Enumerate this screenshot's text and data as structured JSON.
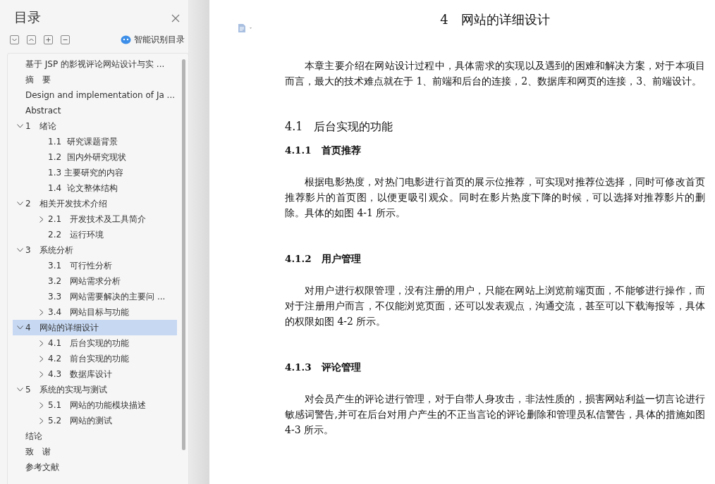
{
  "sidebar": {
    "title": "目录",
    "smart_toc_label": "智能识别目录",
    "items": [
      {
        "label": "基于 JSP 的影视评论网站设计与实 ...",
        "selected": false
      },
      {
        "label": "摘　要",
        "selected": false
      },
      {
        "label": "Design and implementation of Ja ...",
        "selected": false
      },
      {
        "label": "Abstract",
        "selected": false
      },
      {
        "label": "1　绪论",
        "selected": false,
        "expanded": true,
        "children": [
          {
            "label": "1.1  研究课题背景",
            "selected": false
          },
          {
            "label": "1.2  国内外研究现状",
            "selected": false
          },
          {
            "label": "1.3 主要研究的内容",
            "selected": false
          },
          {
            "label": "1.4  论文整体结构",
            "selected": false
          }
        ]
      },
      {
        "label": "2　相关开发技术介绍",
        "selected": false,
        "expanded": true,
        "children": [
          {
            "label": "2.1　开发技术及工具简介",
            "selected": false,
            "expanded": false
          },
          {
            "label": "2.2　运行环境",
            "selected": false
          }
        ]
      },
      {
        "label": "3　系统分析",
        "selected": false,
        "expanded": true,
        "children": [
          {
            "label": "3.1　可行性分析",
            "selected": false
          },
          {
            "label": "3.2　网站需求分析",
            "selected": false
          },
          {
            "label": "3.3　网站需要解决的主要问 ...",
            "selected": false
          },
          {
            "label": "3.4　网站目标与功能",
            "selected": false,
            "expanded": false
          }
        ]
      },
      {
        "label": "4　网站的详细设计",
        "selected": true,
        "expanded": true,
        "children": [
          {
            "label": "4.1　后台实现的功能",
            "selected": false,
            "expanded": false
          },
          {
            "label": "4.2　前台实现的功能",
            "selected": false,
            "expanded": false
          },
          {
            "label": "4.3　数据库设计",
            "selected": false,
            "expanded": false
          }
        ]
      },
      {
        "label": "5　系统的实现与测试",
        "selected": false,
        "expanded": true,
        "children": [
          {
            "label": "5.1　网站的功能模块描述",
            "selected": false,
            "expanded": false
          },
          {
            "label": "5.2　网站的测试",
            "selected": false,
            "expanded": false
          }
        ]
      },
      {
        "label": "结论",
        "selected": false
      },
      {
        "label": "致　谢",
        "selected": false
      },
      {
        "label": "参考文献",
        "selected": false
      }
    ]
  },
  "document": {
    "blocks": [
      {
        "kind": "chapter",
        "text": "4　网站的详细设计"
      },
      {
        "kind": "para",
        "text": "本章主要介绍在网站设计过程中，具体需求的实现以及遇到的困难和解决方案，对于本项目而言，最大的技术难点就在于 1、前端和后台的连接，2、数据库和网页的连接，3、前端设计。"
      },
      {
        "kind": "section",
        "text": "4.1　后台实现的功能"
      },
      {
        "kind": "subsection",
        "text": "4.1.1　首页推荐"
      },
      {
        "kind": "para",
        "text": "根据电影热度，对热门电影进行首页的展示位推荐，可实现对推荐位选择，同时可修改首页推荐影片的首页图，以便更吸引观众。同时在影片热度下降的时候，可以选择对推荐影片的删除。具体的如图 4-1 所示。"
      },
      {
        "kind": "subsection",
        "text": "4.1.2　用户管理"
      },
      {
        "kind": "para",
        "text": "对用户进行权限管理，没有注册的用户，只能在网站上浏览前端页面，不能够进行操作，而对于注册用户而言，不仅能浏览页面，还可以发表观点，沟通交流，甚至可以下载海报等，具体的权限如图 4-2 所示。"
      },
      {
        "kind": "subsection",
        "text": "4.1.3　评论管理"
      },
      {
        "kind": "para",
        "text": "对会员产生的评论进行管理，对于自带人身攻击，非法性质的，损害网站利益一切言论进行敏感词警告,并可在后台对用户产生的不正当言论的评论删除和管理员私信警告，具体的措施如图 4-3 所示。"
      }
    ]
  }
}
